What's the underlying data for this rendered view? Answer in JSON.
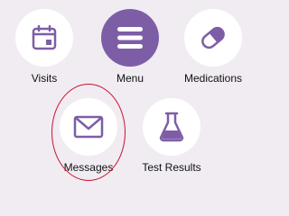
{
  "colors": {
    "background": "#f0ecf2",
    "accent": "#7d5ea6",
    "icon_stroke": "#7d5ea6",
    "annotation": "#c8102e"
  },
  "tiles": [
    {
      "label": "Visits",
      "icon": "calendar-icon"
    },
    {
      "label": "Menu",
      "icon": "hamburger-menu-icon"
    },
    {
      "label": "Medications",
      "icon": "pill-capsule-icon"
    },
    {
      "label": "Messages",
      "icon": "envelope-icon"
    },
    {
      "label": "Test Results",
      "icon": "flask-icon"
    }
  ],
  "annotation": {
    "shape": "ellipse",
    "target": "Messages"
  }
}
